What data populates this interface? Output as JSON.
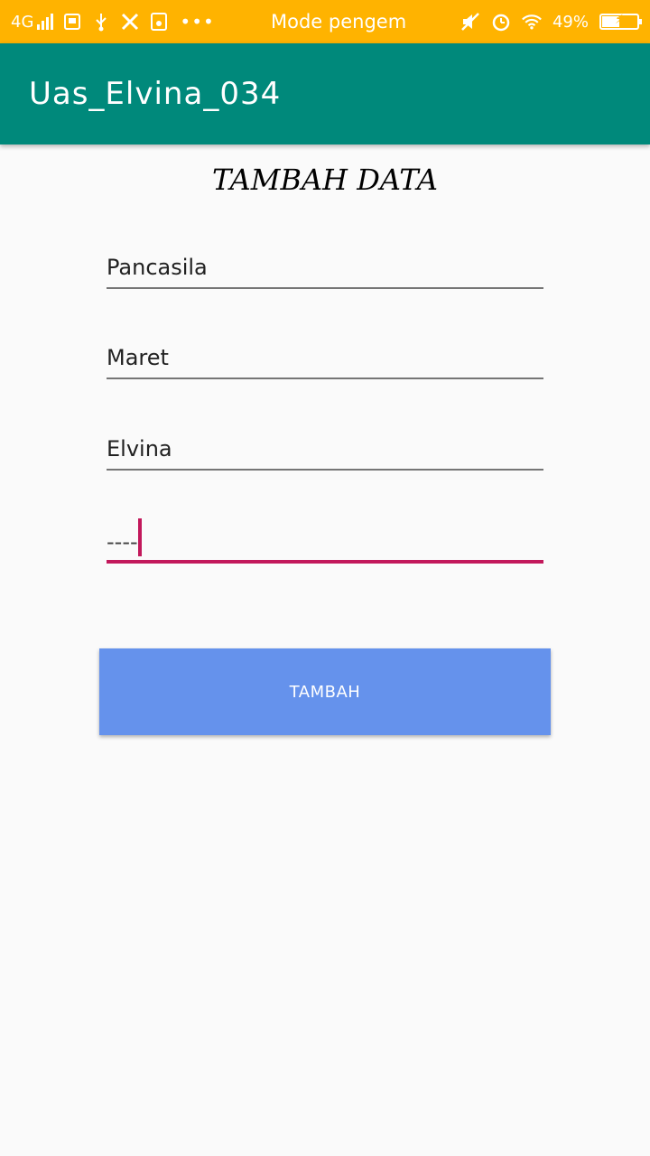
{
  "status_bar": {
    "network": "4G",
    "center_text": "Mode pengemba",
    "battery_percent": "49%",
    "battery_level": 0.49,
    "icons": [
      "signal-icon",
      "sim-icon",
      "usb-icon",
      "tools-icon",
      "storage-icon",
      "more-dots-icon",
      "mute-icon",
      "alarm-icon",
      "wifi-icon",
      "battery-icon"
    ],
    "more": "•••"
  },
  "app_bar": {
    "title": "Uas_Elvina_034",
    "color": "#00897b"
  },
  "form": {
    "heading": "TAMBAH DATA",
    "fields": [
      {
        "value": "Pancasila"
      },
      {
        "value": "Maret"
      },
      {
        "value": "Elvina"
      },
      {
        "value": "----"
      }
    ],
    "submit_label": "TAMBAH",
    "accent_color": "#c2185b",
    "button_color": "#6592ec"
  }
}
